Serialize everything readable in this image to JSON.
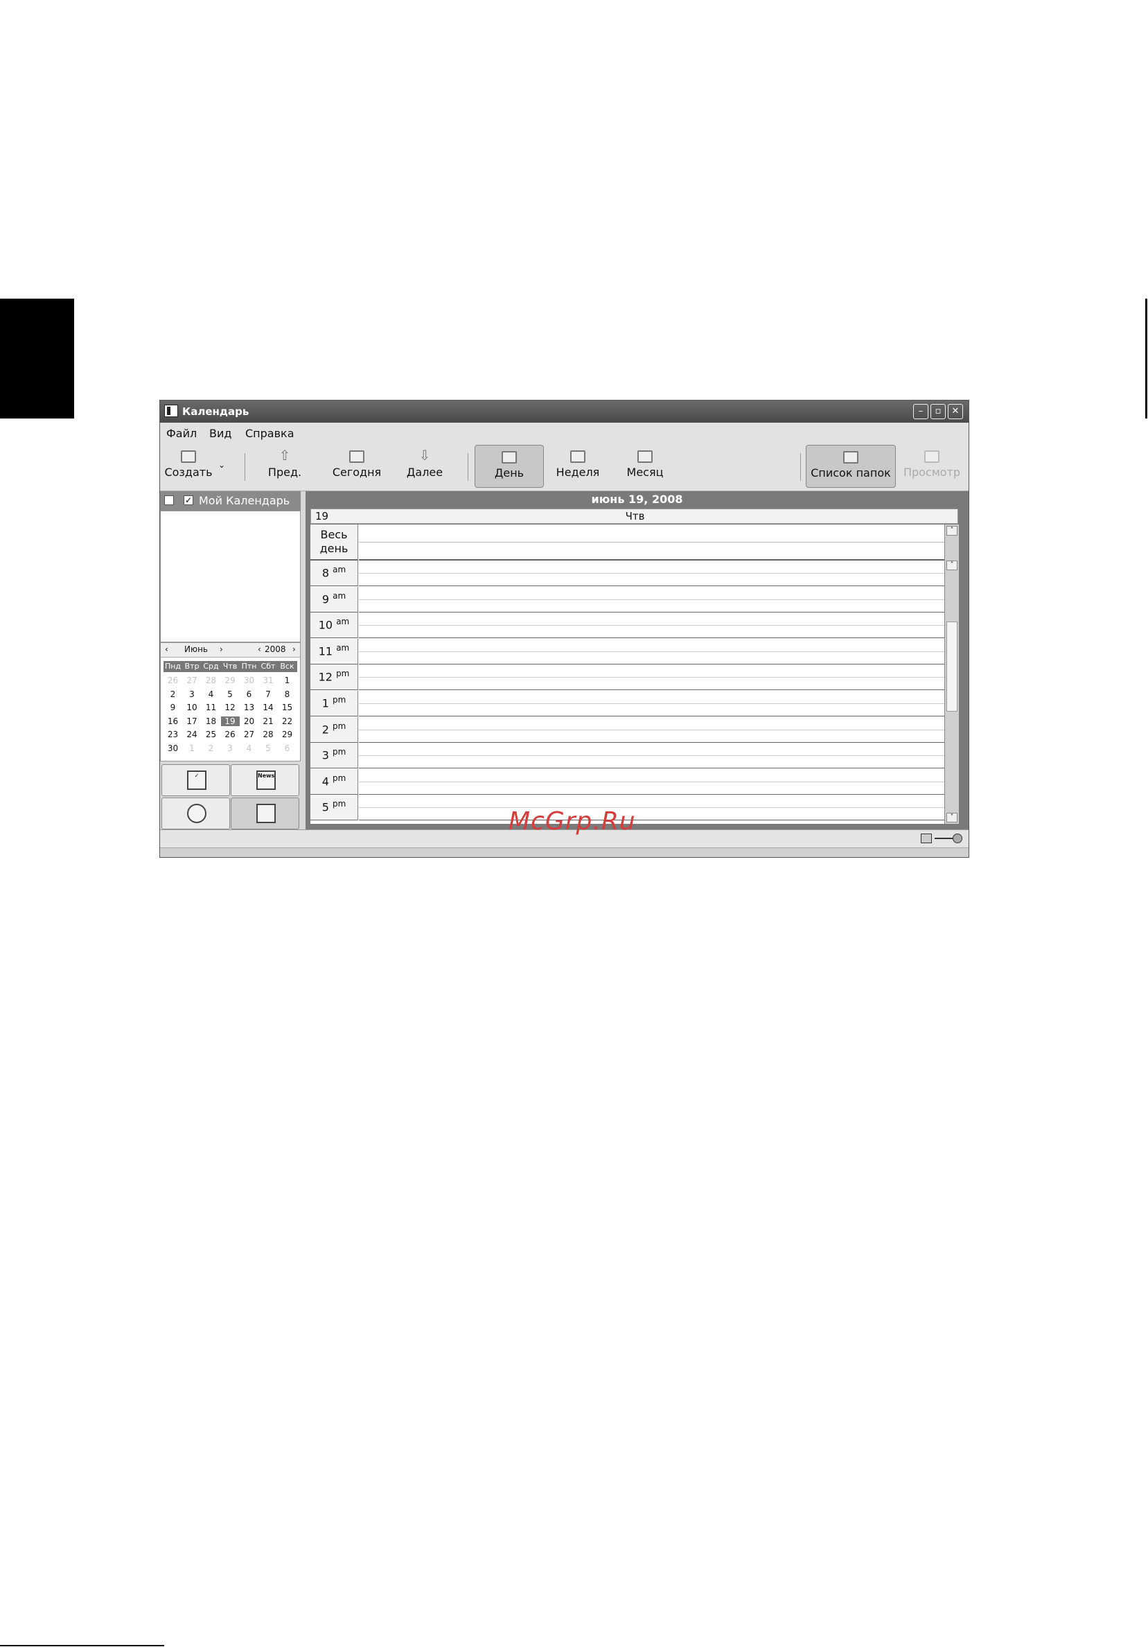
{
  "window": {
    "title": "Календарь",
    "controls": [
      "–",
      "▫",
      "✕"
    ]
  },
  "menu": [
    "Файл",
    "Вид",
    "Справка"
  ],
  "toolbar": {
    "create": "Создать",
    "prev": "Пред.",
    "today": "Сегодня",
    "next": "Далее",
    "day": "День",
    "week": "Неделя",
    "month": "Месяц",
    "folder_list": "Список папок",
    "preview": "Просмотр"
  },
  "sidebar": {
    "calendar_name": "Мой Календарь",
    "minical": {
      "month": "Июнь",
      "year": "2008",
      "weekdays": [
        "Пнд",
        "Втр",
        "Срд",
        "Чтв",
        "Птн",
        "Сбт",
        "Вск"
      ],
      "weeks": [
        [
          "26",
          "27",
          "28",
          "29",
          "30",
          "31",
          "1"
        ],
        [
          "2",
          "3",
          "4",
          "5",
          "6",
          "7",
          "8"
        ],
        [
          "9",
          "10",
          "11",
          "12",
          "13",
          "14",
          "15"
        ],
        [
          "16",
          "17",
          "18",
          "19",
          "20",
          "21",
          "22"
        ],
        [
          "23",
          "24",
          "25",
          "26",
          "27",
          "28",
          "29"
        ],
        [
          "30",
          "1",
          "2",
          "3",
          "4",
          "5",
          "6"
        ]
      ],
      "selected_day": "19"
    },
    "nav_buttons": [
      "mail-icon",
      "news-icon",
      "contacts-icon",
      "calendar-icon"
    ]
  },
  "dayview": {
    "date_title": "июнь 19, 2008",
    "day_number": "19",
    "day_name": "Чтв",
    "allday_line1": "Весь",
    "allday_line2": "день",
    "hours": [
      {
        "h": "8",
        "ap": "am"
      },
      {
        "h": "9",
        "ap": "am"
      },
      {
        "h": "10",
        "ap": "am"
      },
      {
        "h": "11",
        "ap": "am"
      },
      {
        "h": "12",
        "ap": "pm"
      },
      {
        "h": "1",
        "ap": "pm"
      },
      {
        "h": "2",
        "ap": "pm"
      },
      {
        "h": "3",
        "ap": "pm"
      },
      {
        "h": "4",
        "ap": "pm"
      },
      {
        "h": "5",
        "ap": "pm"
      }
    ]
  },
  "watermark": "McGrp.Ru"
}
